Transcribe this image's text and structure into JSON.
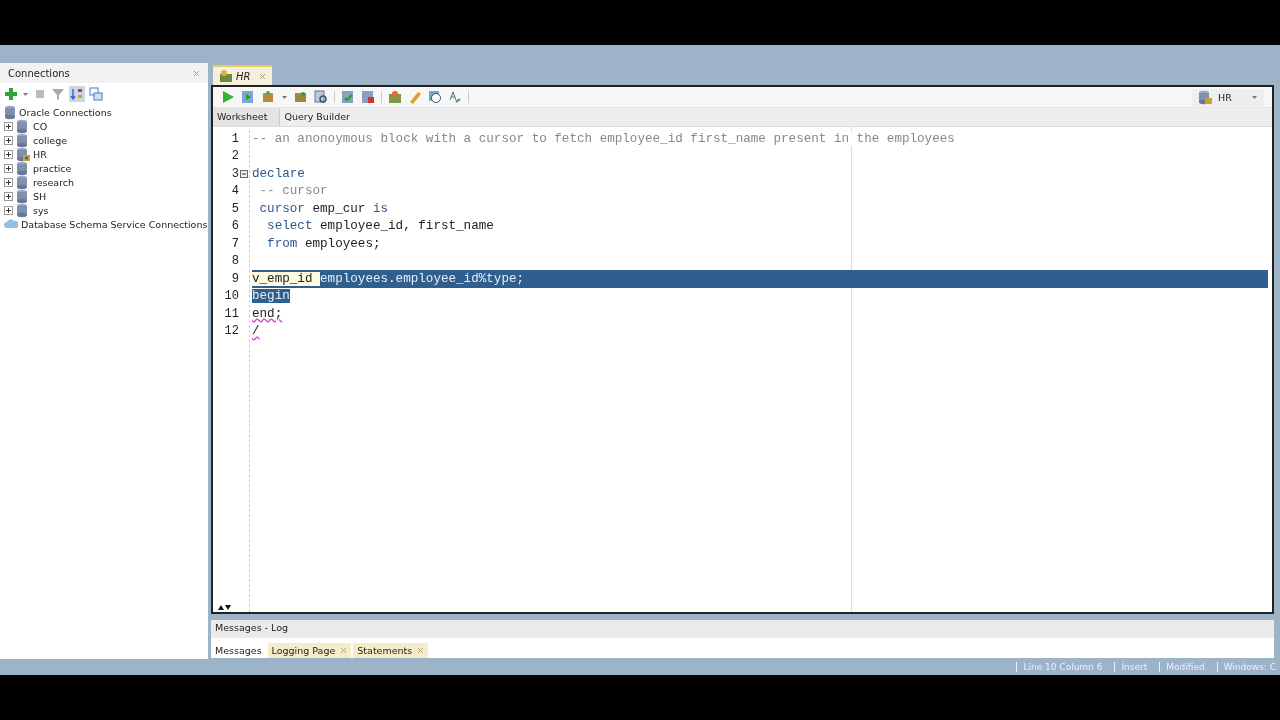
{
  "connections_panel": {
    "title": "Connections",
    "tree": [
      {
        "label": "Oracle Connections",
        "kind": "folder",
        "children": [
          {
            "label": "CO",
            "kind": "db",
            "expanded": false,
            "connected": false
          },
          {
            "label": "college",
            "kind": "db",
            "expanded": false,
            "connected": false
          },
          {
            "label": "HR",
            "kind": "db",
            "expanded": false,
            "connected": true
          },
          {
            "label": "practice",
            "kind": "db",
            "expanded": false,
            "connected": false
          },
          {
            "label": "research",
            "kind": "db",
            "expanded": false,
            "connected": false
          },
          {
            "label": "SH",
            "kind": "db",
            "expanded": false,
            "connected": false
          },
          {
            "label": "sys",
            "kind": "db",
            "expanded": false,
            "connected": false
          }
        ]
      },
      {
        "label": "Database Schema Service Connections",
        "kind": "cloud"
      }
    ]
  },
  "editor": {
    "tab": "HR",
    "connection": "HR",
    "subtabs": [
      {
        "label": "Worksheet",
        "selected": true
      },
      {
        "label": "Query Builder",
        "selected": false
      }
    ],
    "lines": [
      {
        "number": "1",
        "tokens": [
          {
            "text": "-- an anonoymous block with a cursor to fetch employee_id first_name present in the employees",
            "kind": "comment"
          }
        ]
      },
      {
        "number": "2"
      },
      {
        "number": "3",
        "foldable": true,
        "expanded": true,
        "tokens": [
          {
            "text": "declare",
            "kind": "keyword"
          }
        ]
      },
      {
        "number": "4",
        "tokens": [
          {
            "text": " -- cursor",
            "kind": "comment"
          }
        ]
      },
      {
        "number": "5",
        "tokens": [
          {
            "text": " cursor",
            "kind": "keyword"
          },
          {
            "text": " emp_cur ",
            "kind": "plain"
          },
          {
            "text": "is",
            "kind": "keyword"
          }
        ]
      },
      {
        "number": "6",
        "tokens": [
          {
            "text": "  select",
            "kind": "keyword"
          },
          {
            "text": " employee_id, first_name",
            "kind": "plain"
          }
        ]
      },
      {
        "number": "7",
        "tokens": [
          {
            "text": "  from",
            "kind": "keyword"
          },
          {
            "text": " employees;",
            "kind": "plain"
          }
        ]
      },
      {
        "number": "8"
      },
      {
        "number": "9",
        "row_selected": true,
        "tokens": [
          {
            "text": "v_emp_id ",
            "kind": "plain"
          },
          {
            "text": "employees.employee_id%type;",
            "kind": "plain",
            "selected": true
          }
        ]
      },
      {
        "number": "10",
        "tokens": [
          {
            "text": "begin",
            "kind": "plain",
            "selected": true
          }
        ]
      },
      {
        "number": "11",
        "tokens": [
          {
            "text": "end;",
            "kind": "plain",
            "flagged": true
          }
        ]
      },
      {
        "number": "12",
        "tokens": [
          {
            "text": "/",
            "kind": "plain",
            "flagged": true
          }
        ]
      }
    ]
  },
  "log_panel": {
    "title": "Messages - Log",
    "tabs": [
      {
        "label": "Messages",
        "selected": true,
        "closable": false
      },
      {
        "label": "Logging Page",
        "selected": false,
        "closable": true
      },
      {
        "label": "Statements",
        "selected": false,
        "closable": true
      }
    ]
  },
  "status_bar": [
    "Line 10 Column 6",
    "Insert",
    "Modified",
    "Windows: C"
  ]
}
